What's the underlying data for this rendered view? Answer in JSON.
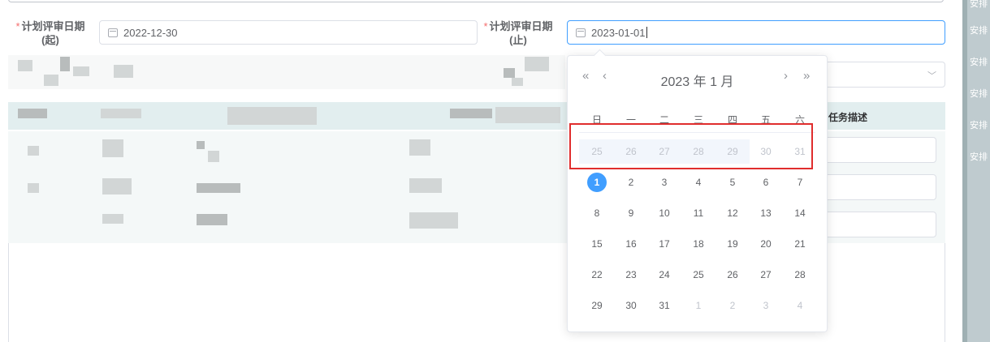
{
  "form": {
    "start_label_required": "*",
    "start_label": "计划评审日期",
    "start_label_suffix": "(起)",
    "start_value": "2022-12-30",
    "end_label_required": "*",
    "end_label": "计划评审日期",
    "end_label_suffix": "(止)",
    "end_value": "2023-01-01"
  },
  "table": {
    "task_desc_header": "任务描述"
  },
  "right_strip": {
    "labels": [
      "安排",
      "安排",
      "安排",
      "安排",
      "安排",
      "安排"
    ]
  },
  "datepicker": {
    "title": "2023 年  1 月",
    "nav": {
      "prev_year": "«",
      "prev_month": "‹",
      "next_month": "›",
      "next_year": "»"
    },
    "weekdays": [
      "日",
      "一",
      "二",
      "三",
      "四",
      "五",
      "六"
    ],
    "weeks": [
      [
        "25",
        "26",
        "27",
        "28",
        "29",
        "30",
        "31"
      ],
      [
        "1",
        "2",
        "3",
        "4",
        "5",
        "6",
        "7"
      ],
      [
        "8",
        "9",
        "10",
        "11",
        "12",
        "13",
        "14"
      ],
      [
        "15",
        "16",
        "17",
        "18",
        "19",
        "20",
        "21"
      ],
      [
        "22",
        "23",
        "24",
        "25",
        "26",
        "27",
        "28"
      ],
      [
        "29",
        "30",
        "31",
        "1",
        "2",
        "3",
        "4"
      ]
    ],
    "selected_date": "1",
    "accent_color": "#409eff",
    "highlight_color": "#e02d2d"
  }
}
